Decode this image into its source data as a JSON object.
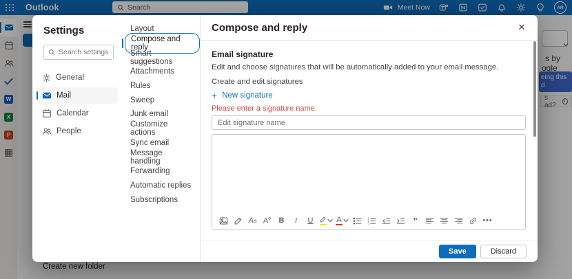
{
  "colors": {
    "accent": "#0f6cbd",
    "error_red": "#c94a50",
    "highlight_yellow": "#f7e200",
    "font_color_red": "#c0392b"
  },
  "top_bar": {
    "app_name": "Outlook",
    "search_placeholder": "Search",
    "meet_now_label": "Meet Now",
    "action_icons": [
      "teams",
      "onenote",
      "tasks",
      "bell",
      "gear",
      "lightbulb"
    ],
    "avatar_initials": "AR"
  },
  "app_rail": {
    "items": [
      {
        "name": "mail",
        "selected": true
      },
      {
        "name": "calendar",
        "selected": false
      },
      {
        "name": "people",
        "selected": false
      },
      {
        "name": "todo",
        "selected": false
      },
      {
        "name": "word",
        "letter": "W",
        "color": "#185abd"
      },
      {
        "name": "excel",
        "letter": "X",
        "color": "#107c41"
      },
      {
        "name": "powerpoint",
        "letter": "P",
        "color": "#c43e1c"
      },
      {
        "name": "more-apps",
        "selected": false
      }
    ]
  },
  "background": {
    "create_new_folder_label": "Create new folder",
    "ad": {
      "text_line1": "s by",
      "text_line2": "ogle",
      "button_line1": "eing this",
      "button_line2": "d",
      "why_label": "s ad?"
    }
  },
  "settings": {
    "title": "Settings",
    "search_placeholder": "Search settings",
    "nav": [
      {
        "label": "General",
        "icon": "gear",
        "selected": false
      },
      {
        "label": "Mail",
        "icon": "mail",
        "selected": true
      },
      {
        "label": "Calendar",
        "icon": "calendar",
        "selected": false
      },
      {
        "label": "People",
        "icon": "people",
        "selected": false
      }
    ],
    "categories": [
      "Layout",
      "Compose and reply",
      "Smart suggestions",
      "Attachments",
      "Rules",
      "Sweep",
      "Junk email",
      "Customize actions",
      "Sync email",
      "Message handling",
      "Forwarding",
      "Automatic replies",
      "Subscriptions"
    ],
    "selected_category": "Compose and reply"
  },
  "detail": {
    "title": "Compose and reply",
    "section_heading": "Email signature",
    "section_description": "Edit and choose signatures that will be automatically added to your email message.",
    "create_edit_label": "Create and edit signatures",
    "new_signature_label": "New signature",
    "error_message": "Please enter a signature name.",
    "signature_name_placeholder": "Edit signature name",
    "toolbar": [
      {
        "name": "image"
      },
      {
        "name": "format-painter"
      },
      {
        "name": "font-style"
      },
      {
        "name": "font-size"
      },
      {
        "name": "bold"
      },
      {
        "name": "italic"
      },
      {
        "name": "underline"
      },
      {
        "name": "highlight",
        "dropdown": true
      },
      {
        "name": "font-color",
        "dropdown": true
      },
      {
        "name": "bulleted-list"
      },
      {
        "name": "numbered-list"
      },
      {
        "name": "outdent"
      },
      {
        "name": "indent"
      },
      {
        "name": "quote"
      },
      {
        "name": "align-left"
      },
      {
        "name": "align-center"
      },
      {
        "name": "align-right"
      },
      {
        "name": "link"
      },
      {
        "name": "more"
      }
    ],
    "save_label": "Save",
    "discard_label": "Discard"
  }
}
